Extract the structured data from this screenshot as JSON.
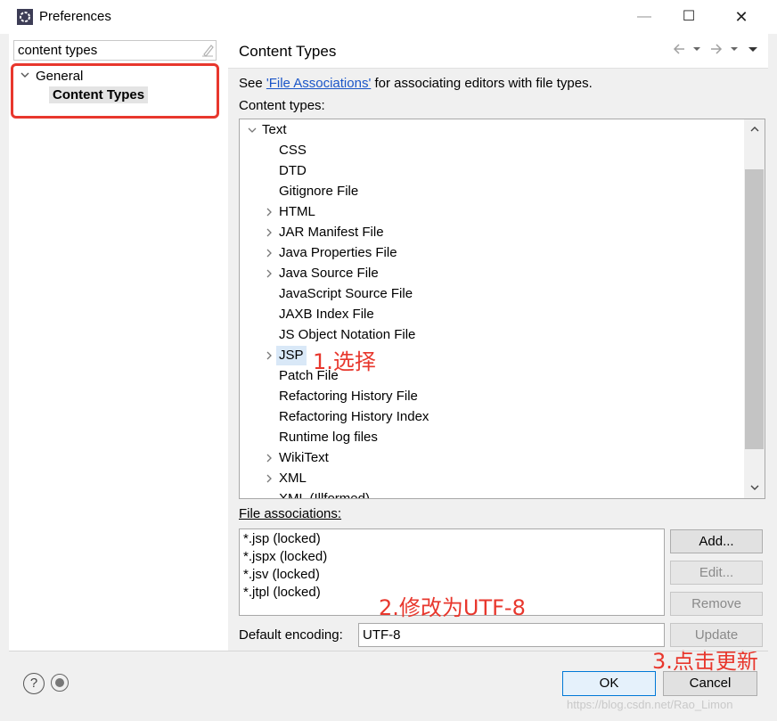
{
  "window": {
    "title": "Preferences",
    "minimize_glyph": "—",
    "maximize_glyph": "☐",
    "close_glyph": "✕"
  },
  "left": {
    "filter_value": "content types",
    "tree": {
      "general": "General",
      "content_types": "Content Types"
    }
  },
  "main": {
    "page_title": "Content Types",
    "see_prefix": "See ",
    "see_link": "'File Associations'",
    "see_suffix": " for associating editors with file types.",
    "content_types_label": "Content types:",
    "tree_items": [
      {
        "label": "Text",
        "depth": 0,
        "chevron": "open"
      },
      {
        "label": "CSS",
        "depth": 1,
        "chevron": "none"
      },
      {
        "label": "DTD",
        "depth": 1,
        "chevron": "none"
      },
      {
        "label": "Gitignore File",
        "depth": 1,
        "chevron": "none"
      },
      {
        "label": "HTML",
        "depth": 1,
        "chevron": "closed"
      },
      {
        "label": "JAR Manifest File",
        "depth": 1,
        "chevron": "closed"
      },
      {
        "label": "Java Properties File",
        "depth": 1,
        "chevron": "closed"
      },
      {
        "label": "Java Source File",
        "depth": 1,
        "chevron": "closed"
      },
      {
        "label": "JavaScript Source File",
        "depth": 1,
        "chevron": "none"
      },
      {
        "label": "JAXB Index File",
        "depth": 1,
        "chevron": "none"
      },
      {
        "label": "JS Object Notation File",
        "depth": 1,
        "chevron": "none"
      },
      {
        "label": "JSP",
        "depth": 1,
        "chevron": "closed",
        "selected": true
      },
      {
        "label": "Patch File",
        "depth": 1,
        "chevron": "none"
      },
      {
        "label": "Refactoring History File",
        "depth": 1,
        "chevron": "none"
      },
      {
        "label": "Refactoring History Index",
        "depth": 1,
        "chevron": "none"
      },
      {
        "label": "Runtime log files",
        "depth": 1,
        "chevron": "none"
      },
      {
        "label": "WikiText",
        "depth": 1,
        "chevron": "closed"
      },
      {
        "label": "XML",
        "depth": 1,
        "chevron": "closed"
      },
      {
        "label": "XML (Illformed)",
        "depth": 1,
        "chevron": "none"
      }
    ],
    "file_assoc_label": "File associations:",
    "file_associations": [
      "*.jsp (locked)",
      "*.jspx (locked)",
      "*.jsv (locked)",
      "*.jtpl (locked)"
    ],
    "buttons": {
      "add": "Add...",
      "edit": "Edit...",
      "remove": "Remove",
      "update": "Update"
    },
    "encoding_label": "Default encoding:",
    "encoding_value": "UTF-8"
  },
  "annotations": {
    "step1": "1.选择",
    "step2": "2.修改为UTF-8",
    "step3": "3.点击更新"
  },
  "footer": {
    "ok": "OK",
    "cancel": "Cancel",
    "help_glyph": "?",
    "watermark": "https://blog.csdn.net/Rao_Limon"
  },
  "colors": {
    "annotation_red": "#e8372d",
    "link_blue": "#1a55c8",
    "default_button_border": "#0078d7"
  }
}
